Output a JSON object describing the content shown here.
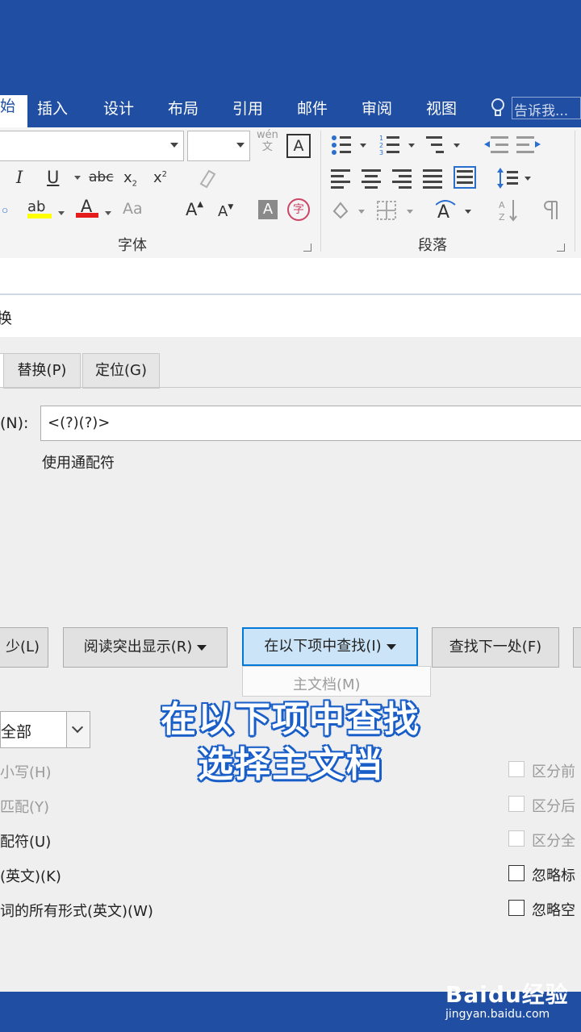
{
  "ribbon": {
    "active_tab_fragment": "始",
    "tabs": [
      "插入",
      "设计",
      "布局",
      "引用",
      "邮件",
      "审阅",
      "视图"
    ],
    "tell_me_placeholder": "告诉我...",
    "font_group_label": "字体",
    "paragraph_group_label": "段落",
    "wen_label_top": "wén",
    "wen_label_bottom": "文",
    "italic": "I",
    "underline": "U",
    "strike": "abc",
    "sub": "x",
    "sup": "x",
    "highlight": "ab",
    "fontcolor": "A",
    "case": "Aa",
    "grow": "A",
    "shrink": "A",
    "shade": "A",
    "char_border": "A",
    "phonetic": "字"
  },
  "dialog": {
    "title_fragment": "换",
    "tabs": [
      "替换(P)",
      "定位(G)"
    ],
    "find_label_fragment": "(N):",
    "find_value": "<(?)(?)>",
    "option_note": "使用通配符",
    "buttons": {
      "less": "少(L)",
      "reading_highlight": "阅读突出显示(R)",
      "find_in": "在以下项中查找(I)",
      "find_next": "查找下一处(F)"
    },
    "find_in_menu_item": "主文档(M)",
    "search_direction_value": "全部",
    "left_options": [
      "大小写(H)",
      "字匹配(Y)",
      "通配符(U)",
      "音(英文)(K)",
      "单词的所有形式(英文)(W)"
    ],
    "right_options": [
      "区分前",
      "区分后",
      "区分全",
      "忽略标",
      "忽略空"
    ]
  },
  "caption": {
    "line1": "在以下项中查找",
    "line2": "选择主文档"
  },
  "watermark": {
    "logo": "Baidu经验",
    "url": "jingyan.baidu.com"
  },
  "colors": {
    "ribbon_blue": "#1f4ea3",
    "focus_blue": "#0078d7",
    "caption_outline": "#1a5fc8"
  }
}
